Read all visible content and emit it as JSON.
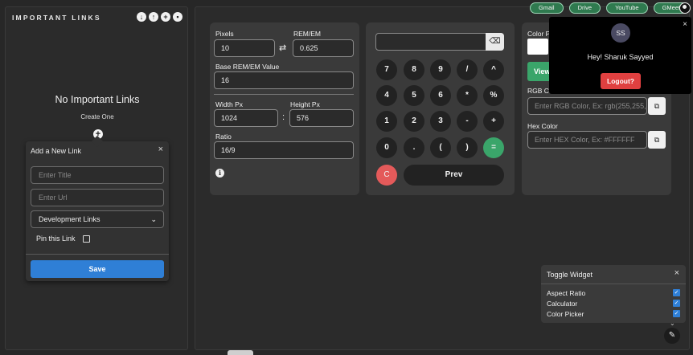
{
  "sidebar": {
    "title": "IMPORTANT LINKS",
    "icons": [
      "download-icon",
      "upload-icon",
      "add-icon",
      "delete-icon"
    ],
    "empty_text": "No Important Links",
    "create_text": "Create One"
  },
  "add_link_popup": {
    "title": "Add a New Link",
    "close": "×",
    "title_placeholder": "Enter Title",
    "url_placeholder": "Enter Url",
    "category_value": "Development Links",
    "pin_label": "Pin this Link",
    "pin_checked": false,
    "save_label": "Save"
  },
  "aspect_ratio": {
    "pixels_label": "Pixels",
    "pixels_value": "10",
    "swap_symbol": "⇄",
    "rem_label": "REM/EM",
    "rem_value": "0.625",
    "base_label": "Base REM/EM Value",
    "base_value": "16",
    "width_label": "Width Px",
    "width_value": "1024",
    "colon": ":",
    "height_label": "Height Px",
    "height_value": "576",
    "ratio_label": "Ratio",
    "ratio_value": "16/9",
    "info_icon": "i"
  },
  "calculator": {
    "backspace_icon": "⌫",
    "rows": [
      [
        "7",
        "8",
        "9",
        "/",
        "^"
      ],
      [
        "4",
        "5",
        "6",
        "*",
        "%"
      ],
      [
        "1",
        "2",
        "3",
        "-",
        "+"
      ],
      [
        "0",
        ".",
        "(",
        ")",
        "="
      ]
    ],
    "clear_label": "C",
    "prev_label": "Prev",
    "equals_color": "#3aa56a",
    "clear_color": "#e45a5a"
  },
  "color_picker": {
    "color_label": "Color P",
    "view_label": "View",
    "rgb_label": "RGB Color",
    "rgb_placeholder": "Enter RGB Color, Ex: rgb(255,255,",
    "hex_label": "Hex Color",
    "hex_placeholder": "Enter HEX Color, Ex: #FFFFFF",
    "copy_icon": "⧉"
  },
  "quick_links": [
    "Gmail",
    "Drive",
    "YouTube",
    "GMeet"
  ],
  "profile": {
    "initials": "SS",
    "greeting": "Hey! Sharuk Sayyed",
    "logout_label": "Logout?",
    "close": "×"
  },
  "toggle_widget": {
    "title": "Toggle Widget",
    "close": "×",
    "items": [
      {
        "label": "Aspect Ratio",
        "checked": true
      },
      {
        "label": "Calculator",
        "checked": true
      },
      {
        "label": "Color Picker",
        "checked": true
      }
    ],
    "collapse_icon": "⌄",
    "edit_icon": "✎"
  },
  "colors": {
    "background": "#272727",
    "card": "#3a3a3a",
    "accent_green": "#3aa56a",
    "accent_blue": "#2f7fd6",
    "accent_red": "#e04040"
  }
}
